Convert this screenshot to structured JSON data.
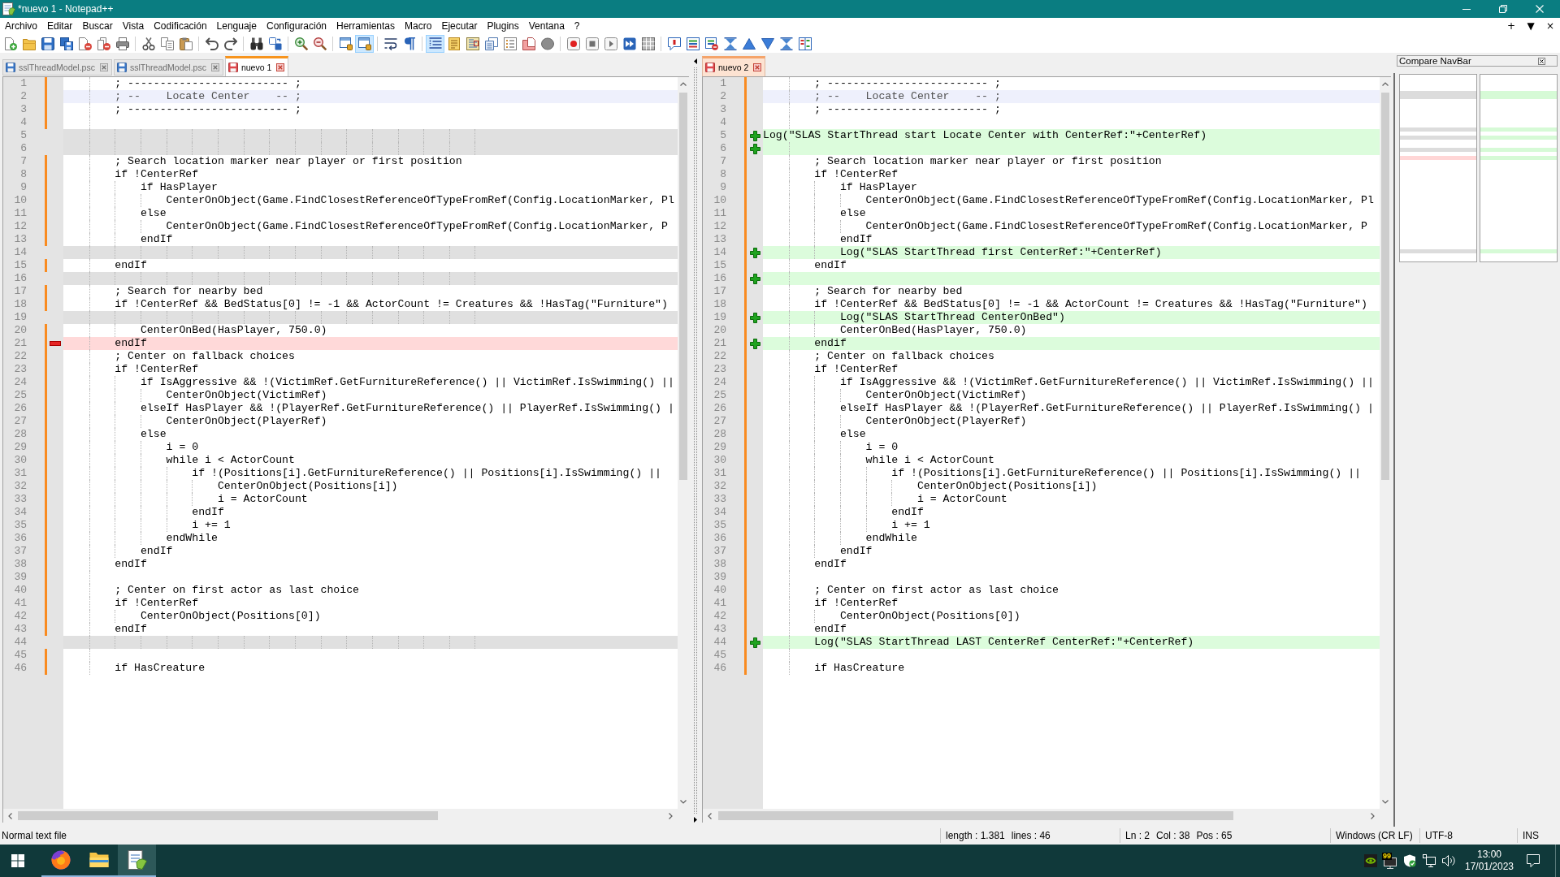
{
  "window": {
    "title": "*nuevo 1 - Notepad++"
  },
  "menu": [
    "Archivo",
    "Editar",
    "Buscar",
    "Vista",
    "Codificación",
    "Lenguaje",
    "Configuración",
    "Herramientas",
    "Macro",
    "Ejecutar",
    "Plugins",
    "Ventana",
    "?"
  ],
  "menu_controls": [
    "+",
    "▼",
    "×"
  ],
  "toolbar": [
    [
      {
        "pressed": false
      },
      {
        "pressed": false
      },
      {
        "pressed": false
      },
      {
        "pressed": false
      },
      {
        "pressed": false
      },
      {
        "pressed": false
      },
      {
        "pressed": false
      }
    ],
    [
      {
        "pressed": false
      },
      {
        "pressed": false
      },
      {
        "pressed": false
      }
    ],
    [
      {
        "pressed": false
      },
      {
        "pressed": false
      }
    ],
    [
      {
        "pressed": false
      },
      {
        "pressed": false
      }
    ],
    [
      {
        "pressed": false
      },
      {
        "pressed": false
      }
    ],
    [
      {
        "pressed": false
      },
      {
        "pressed": true
      }
    ],
    [
      {
        "pressed": false
      },
      {
        "pressed": false
      }
    ],
    [
      {
        "pressed": true
      },
      {
        "pressed": false
      },
      {
        "pressed": false
      },
      {
        "pressed": false
      },
      {
        "pressed": false
      },
      {
        "pressed": false
      },
      {
        "pressed": false
      }
    ],
    [
      {
        "pressed": false
      },
      {
        "pressed": false
      },
      {
        "pressed": false
      },
      {
        "pressed": false
      },
      {
        "pressed": false
      }
    ],
    [
      {
        "pressed": false
      },
      {
        "pressed": false
      },
      {
        "pressed": false
      },
      {
        "pressed": false
      },
      {
        "pressed": false
      },
      {
        "pressed": false
      },
      {
        "pressed": false
      },
      {
        "pressed": false
      }
    ]
  ],
  "views": [
    {
      "focused": true,
      "tabs": [
        {
          "label": "sslThreadModel.psc",
          "selected": false,
          "modified": false
        },
        {
          "label": "sslThreadModel.psc",
          "selected": false,
          "modified": false
        },
        {
          "label": "nuevo 1",
          "selected": true,
          "modified": true
        }
      ],
      "lines": [
        {
          "number": "1",
          "kind": "normal",
          "text": "        ; ------------------------- ;"
        },
        {
          "number": "2",
          "kind": "current",
          "text": "        ; --    Locate Center    -- ;"
        },
        {
          "number": "3",
          "kind": "normal",
          "text": "        ; ------------------------- ;"
        },
        {
          "number": "4",
          "kind": "normal"
        },
        {
          "number": "5",
          "kind": "blank"
        },
        {
          "number": "6",
          "kind": "blank"
        },
        {
          "number": "7",
          "kind": "normal",
          "text": "        ; Search location marker near player or first position"
        },
        {
          "number": "8",
          "kind": "normal",
          "text": "        if !CenterRef"
        },
        {
          "number": "9",
          "kind": "normal",
          "text": "            if HasPlayer"
        },
        {
          "number": "10",
          "kind": "normal",
          "text": "                CenterOnObject(Game.FindClosestReferenceOfTypeFromRef(Config.LocationMarker, Pl"
        },
        {
          "number": "11",
          "kind": "normal",
          "text": "            else"
        },
        {
          "number": "12",
          "kind": "normal",
          "text": "                CenterOnObject(Game.FindClosestReferenceOfTypeFromRef(Config.LocationMarker, P"
        },
        {
          "number": "13",
          "kind": "normal",
          "text": "            endIf"
        },
        {
          "number": "14",
          "kind": "blank"
        },
        {
          "number": "15",
          "kind": "normal",
          "text": "        endIf"
        },
        {
          "number": "16",
          "kind": "blank"
        },
        {
          "number": "17",
          "kind": "normal",
          "text": "        ; Search for nearby bed"
        },
        {
          "number": "18",
          "kind": "normal",
          "text": "        if !CenterRef && BedStatus[0] != -1 && ActorCount != Creatures && !HasTag(\"Furniture\")"
        },
        {
          "number": "19",
          "kind": "blank"
        },
        {
          "number": "20",
          "kind": "normal",
          "text": "            CenterOnBed(HasPlayer, 750.0)"
        },
        {
          "number": "21",
          "kind": "removed",
          "text": "        endIf"
        },
        {
          "number": "22",
          "kind": "normal",
          "text": "        ; Center on fallback choices"
        },
        {
          "number": "23",
          "kind": "normal",
          "text": "        if !CenterRef"
        },
        {
          "number": "24",
          "kind": "normal",
          "text": "            if IsAggressive && !(VictimRef.GetFurnitureReference() || VictimRef.IsSwimming() ||"
        },
        {
          "number": "25",
          "kind": "normal",
          "text": "                CenterOnObject(VictimRef)"
        },
        {
          "number": "26",
          "kind": "normal",
          "text": "            elseIf HasPlayer && !(PlayerRef.GetFurnitureReference() || PlayerRef.IsSwimming() |"
        },
        {
          "number": "27",
          "kind": "normal",
          "text": "                CenterOnObject(PlayerRef)"
        },
        {
          "number": "28",
          "kind": "normal",
          "text": "            else"
        },
        {
          "number": "29",
          "kind": "normal",
          "text": "                i = 0"
        },
        {
          "number": "30",
          "kind": "normal",
          "text": "                while i < ActorCount"
        },
        {
          "number": "31",
          "kind": "normal",
          "text": "                    if !(Positions[i].GetFurnitureReference() || Positions[i].IsSwimming() ||"
        },
        {
          "number": "32",
          "kind": "normal",
          "text": "                        CenterOnObject(Positions[i])"
        },
        {
          "number": "33",
          "kind": "normal",
          "text": "                        i = ActorCount"
        },
        {
          "number": "34",
          "kind": "normal",
          "text": "                    endIf"
        },
        {
          "number": "35",
          "kind": "normal",
          "text": "                    i += 1"
        },
        {
          "number": "36",
          "kind": "normal",
          "text": "                endWhile"
        },
        {
          "number": "37",
          "kind": "normal",
          "text": "            endIf"
        },
        {
          "number": "38",
          "kind": "normal",
          "text": "        endIf"
        },
        {
          "number": "39",
          "kind": "normal"
        },
        {
          "number": "40",
          "kind": "normal",
          "text": "        ; Center on first actor as last choice"
        },
        {
          "number": "41",
          "kind": "normal",
          "text": "        if !CenterRef"
        },
        {
          "number": "42",
          "kind": "normal",
          "text": "            CenterOnObject(Positions[0])"
        },
        {
          "number": "43",
          "kind": "normal",
          "text": "        endIf"
        },
        {
          "number": "44",
          "kind": "blank"
        },
        {
          "number": "45",
          "kind": "normal"
        },
        {
          "number": "46",
          "kind": "normal",
          "text": "        if HasCreature"
        }
      ]
    },
    {
      "focused": false,
      "tabs": [
        {
          "label": "nuevo 2",
          "selected": true,
          "modified": true
        }
      ],
      "lines": [
        {
          "number": "1",
          "kind": "normal",
          "text": "        ; ------------------------- ;"
        },
        {
          "number": "2",
          "kind": "current",
          "text": "        ; --    Locate Center    -- ;"
        },
        {
          "number": "3",
          "kind": "normal",
          "text": "        ; ------------------------- ;"
        },
        {
          "number": "4",
          "kind": "normal"
        },
        {
          "number": "5",
          "kind": "added",
          "text": "Log(\"SLAS StartThread start Locate Center with CenterRef:\"+CenterRef)"
        },
        {
          "number": "6",
          "kind": "added"
        },
        {
          "number": "7",
          "kind": "normal",
          "text": "        ; Search location marker near player or first position"
        },
        {
          "number": "8",
          "kind": "normal",
          "text": "        if !CenterRef"
        },
        {
          "number": "9",
          "kind": "normal",
          "text": "            if HasPlayer"
        },
        {
          "number": "10",
          "kind": "normal",
          "text": "                CenterOnObject(Game.FindClosestReferenceOfTypeFromRef(Config.LocationMarker, Pl"
        },
        {
          "number": "11",
          "kind": "normal",
          "text": "            else"
        },
        {
          "number": "12",
          "kind": "normal",
          "text": "                CenterOnObject(Game.FindClosestReferenceOfTypeFromRef(Config.LocationMarker, P"
        },
        {
          "number": "13",
          "kind": "normal",
          "text": "            endIf"
        },
        {
          "number": "14",
          "kind": "added",
          "text": "            Log(\"SLAS StartThread first CenterRef:\"+CenterRef)"
        },
        {
          "number": "15",
          "kind": "normal",
          "text": "        endIf"
        },
        {
          "number": "16",
          "kind": "added"
        },
        {
          "number": "17",
          "kind": "normal",
          "text": "        ; Search for nearby bed"
        },
        {
          "number": "18",
          "kind": "normal",
          "text": "        if !CenterRef && BedStatus[0] != -1 && ActorCount != Creatures && !HasTag(\"Furniture\")"
        },
        {
          "number": "19",
          "kind": "added",
          "text": "            Log(\"SLAS StartThread CenterOnBed\")"
        },
        {
          "number": "20",
          "kind": "normal",
          "text": "            CenterOnBed(HasPlayer, 750.0)"
        },
        {
          "number": "21",
          "kind": "added",
          "text": "        endif"
        },
        {
          "number": "22",
          "kind": "normal",
          "text": "        ; Center on fallback choices"
        },
        {
          "number": "23",
          "kind": "normal",
          "text": "        if !CenterRef"
        },
        {
          "number": "24",
          "kind": "normal",
          "text": "            if IsAggressive && !(VictimRef.GetFurnitureReference() || VictimRef.IsSwimming() ||"
        },
        {
          "number": "25",
          "kind": "normal",
          "text": "                CenterOnObject(VictimRef)"
        },
        {
          "number": "26",
          "kind": "normal",
          "text": "            elseIf HasPlayer && !(PlayerRef.GetFurnitureReference() || PlayerRef.IsSwimming() |"
        },
        {
          "number": "27",
          "kind": "normal",
          "text": "                CenterOnObject(PlayerRef)"
        },
        {
          "number": "28",
          "kind": "normal",
          "text": "            else"
        },
        {
          "number": "29",
          "kind": "normal",
          "text": "                i = 0"
        },
        {
          "number": "30",
          "kind": "normal",
          "text": "                while i < ActorCount"
        },
        {
          "number": "31",
          "kind": "normal",
          "text": "                    if !(Positions[i].GetFurnitureReference() || Positions[i].IsSwimming() ||"
        },
        {
          "number": "32",
          "kind": "normal",
          "text": "                        CenterOnObject(Positions[i])"
        },
        {
          "number": "33",
          "kind": "normal",
          "text": "                        i = ActorCount"
        },
        {
          "number": "34",
          "kind": "normal",
          "text": "                    endIf"
        },
        {
          "number": "35",
          "kind": "normal",
          "text": "                    i += 1"
        },
        {
          "number": "36",
          "kind": "normal",
          "text": "                endWhile"
        },
        {
          "number": "37",
          "kind": "normal",
          "text": "            endIf"
        },
        {
          "number": "38",
          "kind": "normal",
          "text": "        endIf"
        },
        {
          "number": "39",
          "kind": "normal"
        },
        {
          "number": "40",
          "kind": "normal",
          "text": "        ; Center on first actor as last choice"
        },
        {
          "number": "41",
          "kind": "normal",
          "text": "        if !CenterRef"
        },
        {
          "number": "42",
          "kind": "normal",
          "text": "            CenterOnObject(Positions[0])"
        },
        {
          "number": "43",
          "kind": "normal",
          "text": "        endIf"
        },
        {
          "number": "44",
          "kind": "added",
          "text": "        Log(\"SLAS StartThread LAST CenterRef CenterRef:\"+CenterRef)"
        },
        {
          "number": "45",
          "kind": "normal"
        },
        {
          "number": "46",
          "kind": "normal",
          "text": "        if HasCreature"
        }
      ]
    }
  ],
  "compare_navbar": {
    "title": "Compare NavBar"
  },
  "status_bar": {
    "file_type": "Normal text file",
    "length": "length : 1.381",
    "lines": "lines : 46",
    "line": "Ln : 2",
    "column": "Col : 38",
    "position": "Pos : 65",
    "line_endings": "Windows (CR LF)",
    "encoding": "UTF-8",
    "mode": "INS"
  },
  "taskbar": {
    "apps": [
      {
        "selected": false
      },
      {
        "selected": false
      },
      {
        "selected": true
      }
    ],
    "tray_badge": "99",
    "time": "13:00",
    "date": "17/01/2023"
  }
}
